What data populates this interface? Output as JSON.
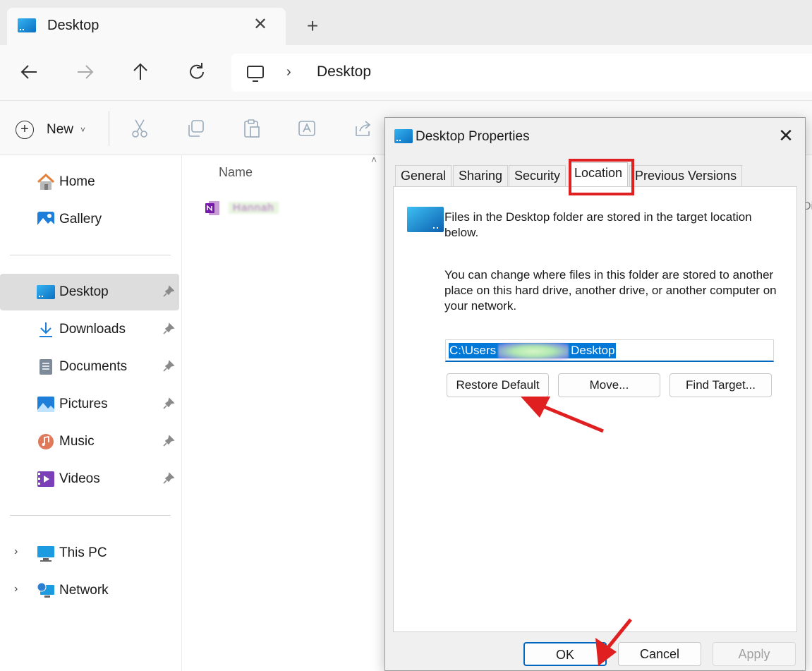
{
  "tab": {
    "title": "Desktop",
    "close": "✕",
    "new_tab": "+"
  },
  "nav": {
    "back": "←",
    "forward": "→",
    "up": "↑",
    "refresh": "↻",
    "chevron": "›",
    "location": "Desktop"
  },
  "commands": {
    "new_label": "New",
    "new_caret": "˅",
    "icons": [
      "cut-icon",
      "copy-icon",
      "paste-icon",
      "rename-icon",
      "share-icon"
    ]
  },
  "sidebar": {
    "items": [
      {
        "label": "Home",
        "icon": "home-icon"
      },
      {
        "label": "Gallery",
        "icon": "gallery-icon"
      },
      {
        "label": "Desktop",
        "icon": "desktop-icon",
        "pinned": true,
        "active": true
      },
      {
        "label": "Downloads",
        "icon": "downloads-icon",
        "pinned": true
      },
      {
        "label": "Documents",
        "icon": "documents-icon",
        "pinned": true
      },
      {
        "label": "Pictures",
        "icon": "pictures-icon",
        "pinned": true
      },
      {
        "label": "Music",
        "icon": "music-icon",
        "pinned": true
      },
      {
        "label": "Videos",
        "icon": "videos-icon",
        "pinned": true
      },
      {
        "label": "This PC",
        "icon": "this-pc-icon",
        "expandable": true
      },
      {
        "label": "Network",
        "icon": "network-icon",
        "expandable": true
      }
    ],
    "expand_glyph": "›"
  },
  "content": {
    "column_name": "Name",
    "sort_caret": "˄",
    "file": {
      "name": "Hannah",
      "icon": "onenote-icon"
    },
    "edge_hint": "Di"
  },
  "dialog": {
    "title": "Desktop Properties",
    "close": "✕",
    "tabs": [
      "General",
      "Sharing",
      "Security",
      "Location",
      "Previous Versions"
    ],
    "selected_tab": "Location",
    "info_text": "Files in the Desktop folder are stored in the target location below.",
    "help_text": "You can change where files in this folder are stored to another place on this hard drive, another drive, or another computer on your network.",
    "path_value": "C:\\Users\\Hannah\\Desktop",
    "path_prefix": "C:\\Users",
    "path_suffix": "Desktop",
    "buttons": {
      "restore": "Restore Default",
      "move": "Move...",
      "find_target": "Find Target..."
    },
    "footer": {
      "ok": "OK",
      "cancel": "Cancel",
      "apply": "Apply"
    }
  },
  "colors": {
    "accent": "#0067c0",
    "selection": "#0078d7",
    "annotation": "#e02020",
    "sidebar_active": "#dddddd"
  }
}
